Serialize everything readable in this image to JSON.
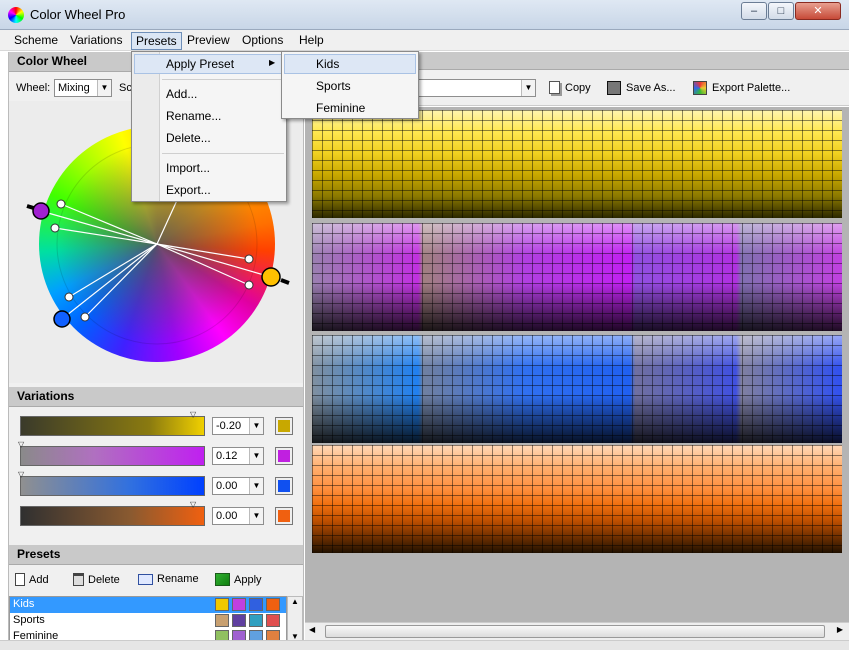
{
  "window": {
    "title": "Color Wheel Pro",
    "min": "–",
    "max": "□",
    "close": "✕"
  },
  "menu": [
    "Scheme",
    "Variations",
    "Presets",
    "Preview",
    "Options",
    "Help"
  ],
  "presets_menu": {
    "apply_preset": "Apply Preset",
    "add": "Add...",
    "rename": "Rename...",
    "delete": "Delete...",
    "import": "Import...",
    "export": "Export..."
  },
  "submenu": [
    "Kids",
    "Sports",
    "Feminine"
  ],
  "color_wheel": {
    "header": "Color Wheel",
    "wheel_label": "Wheel:",
    "wheel_value": "Mixing",
    "scheme_label_partial": "Sc"
  },
  "toolbar": {
    "copy": "Copy",
    "save_as": "Save As...",
    "export_palette": "Export Palette..."
  },
  "variations": {
    "header": "Variations",
    "rows": [
      {
        "value": "-0.20",
        "color": "#c8a800",
        "bar": "linear-gradient(90deg,#3a3a2a,#8a7a10 70%,#f0d000)"
      },
      {
        "value": "0.12",
        "color": "#c020e0",
        "bar": "linear-gradient(90deg,#8a8a8a,#b070c0 40%,#c020f0)"
      },
      {
        "value": "0.00",
        "color": "#1050f0",
        "bar": "linear-gradient(90deg,#909090,#3070e0 60%,#0040ff)"
      },
      {
        "value": "0.00",
        "color": "#f06010",
        "bar": "linear-gradient(90deg,#303030,#8a5a30 60%,#f06010)"
      }
    ]
  },
  "presets": {
    "header": "Presets",
    "add": "Add",
    "delete": "Delete",
    "rename": "Rename",
    "apply": "Apply",
    "items": [
      {
        "name": "Kids",
        "colors": [
          "#f0c800",
          "#c040e0",
          "#3060e0",
          "#f06010"
        ]
      },
      {
        "name": "Sports",
        "colors": [
          "#c8a070",
          "#6040a0",
          "#30a0c0",
          "#e05050"
        ]
      },
      {
        "name": "Feminine",
        "colors": [
          "#90c060",
          "#a060d0",
          "#60a0e0",
          "#e08040"
        ]
      }
    ]
  },
  "colors": {
    "accent": "#3399ff",
    "palette": [
      "#f0d020",
      "#c030e0",
      "#2080f0",
      "#f07020"
    ]
  }
}
